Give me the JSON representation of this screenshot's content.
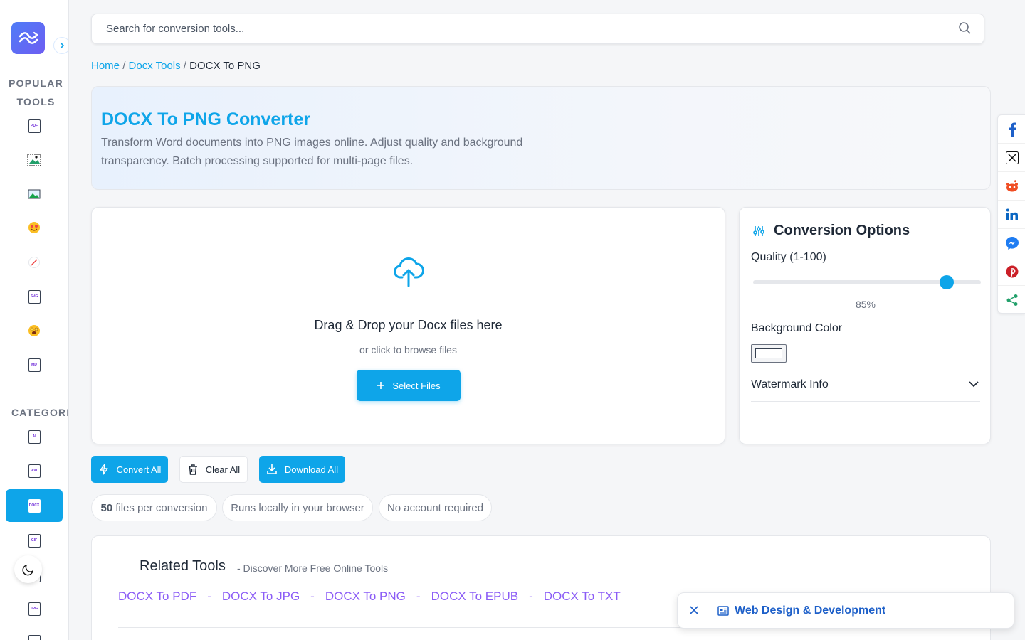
{
  "sidebar": {
    "popular_heading": "POPULAR TOOLS",
    "categories_heading": "CATEGORIES",
    "popular_icons": [
      {
        "name": "pdf-file-icon",
        "label": "PDF"
      },
      {
        "name": "image-frame-icon",
        "label": ""
      },
      {
        "name": "image-icon",
        "label": ""
      },
      {
        "name": "heart-eyes-emoji-icon",
        "label": ""
      },
      {
        "name": "slash-icon",
        "label": ""
      },
      {
        "name": "svg-file-icon",
        "label": "SVG"
      },
      {
        "name": "star-eyes-emoji-icon",
        "label": ""
      },
      {
        "name": "md-file-icon",
        "label": "MD"
      }
    ],
    "category_icons": [
      {
        "name": "ai-file-icon",
        "label": "AI"
      },
      {
        "name": "avi-file-icon",
        "label": "AVI"
      },
      {
        "name": "docx-file-icon",
        "label": "DOCX"
      },
      {
        "name": "gif-file-icon",
        "label": "GIF"
      },
      {
        "name": "file-icon",
        "label": ""
      },
      {
        "name": "jpg-file-icon",
        "label": "JPG"
      }
    ]
  },
  "search": {
    "placeholder": "Search for conversion tools..."
  },
  "breadcrumb": {
    "home": "Home",
    "section": "Docx Tools",
    "current": "DOCX To PNG"
  },
  "hero": {
    "title": "DOCX To PNG Converter",
    "description": "Transform Word documents into PNG images online. Adjust quality and background transparency. Batch processing supported for multi-page files."
  },
  "upload": {
    "title": "Drag & Drop your Docx files here",
    "subtitle": "or click to browse files",
    "button": "Select Files"
  },
  "options": {
    "title": "Conversion Options",
    "quality_label": "Quality (1-100)",
    "quality_value": 85,
    "quality_text": "85%",
    "background_label": "Background Color",
    "background_color": "#ffffff",
    "watermark_label": "Watermark Info"
  },
  "actions": {
    "convert": "Convert All",
    "clear": "Clear All",
    "download": "Download All"
  },
  "pills": {
    "files_count": "50",
    "files_text": "files per conversion",
    "local": "Runs locally in your browser",
    "account": "No account required"
  },
  "related": {
    "title": "Related Tools",
    "subtitle": "- Discover More Free Online Tools",
    "separator": "-",
    "links": [
      "DOCX To PDF",
      "DOCX To JPG",
      "DOCX To PNG",
      "DOCX To EPUB",
      "DOCX To TXT"
    ]
  },
  "share": [
    "facebook-icon",
    "x-twitter-icon",
    "reddit-icon",
    "linkedin-icon",
    "messenger-icon",
    "pinterest-icon",
    "share-icon"
  ],
  "toast": {
    "text": "Web Design & Development"
  },
  "colors": {
    "accent": "#0ea5e9",
    "link_purple": "#8b5cf6",
    "toast_blue": "#1e60c9"
  }
}
